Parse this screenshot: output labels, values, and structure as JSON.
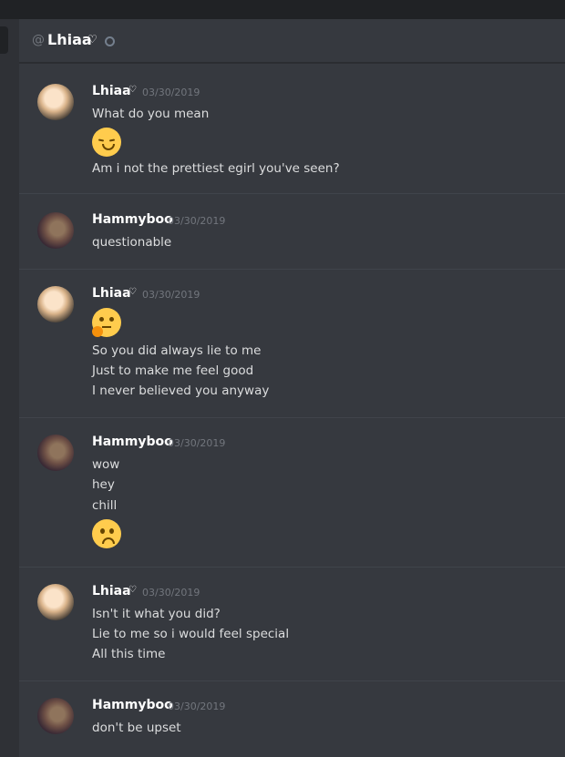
{
  "header": {
    "at": "@",
    "name": "Lhiaa",
    "heart": "♡"
  },
  "colors": {
    "bg": "#36393f",
    "text": "#dcddde",
    "muted": "#72767d",
    "emoji": "#ffcc4d"
  },
  "messages": [
    {
      "author": "Lhiaa",
      "heart": "♡",
      "timestamp": "03/30/2019",
      "avatar": "lhiaa-avatar",
      "lines": [
        "What do you mean",
        "Am i not the prettiest egirl you've seen?"
      ],
      "emoji": "relieved-face-emoji"
    },
    {
      "author": "Hammyboo",
      "timestamp": "03/30/2019",
      "avatar": "hammyboo-avatar",
      "lines": [
        "questionable"
      ]
    },
    {
      "author": "Lhiaa",
      "heart": "♡",
      "timestamp": "03/30/2019",
      "avatar": "lhiaa-avatar",
      "lines": [
        "So you did always lie to me",
        "Just to make me feel good",
        "I never believed you anyway"
      ],
      "emoji": "thinking-face-emoji"
    },
    {
      "author": "Hammyboo",
      "timestamp": "03/30/2019",
      "avatar": "hammyboo-avatar",
      "lines": [
        "wow",
        "hey",
        "chill"
      ],
      "emoji": "frowning-face-emoji"
    },
    {
      "author": "Lhiaa",
      "heart": "♡",
      "timestamp": "03/30/2019",
      "avatar": "lhiaa-avatar",
      "lines": [
        "Isn't it what you did?",
        "Lie to me so i would feel special",
        "All this time"
      ]
    },
    {
      "author": "Hammyboo",
      "timestamp": "03/30/2019",
      "avatar": "hammyboo-avatar",
      "lines": [
        "don't be upset"
      ]
    }
  ]
}
